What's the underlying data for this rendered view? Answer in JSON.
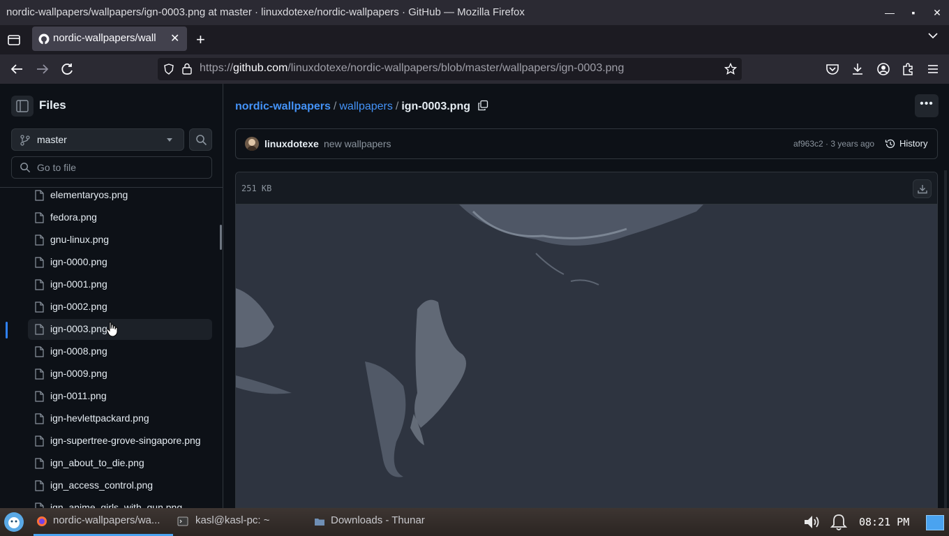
{
  "window": {
    "title": "nordic-wallpapers/wallpapers/ign-0003.png at master · linuxdotexe/nordic-wallpapers · GitHub — Mozilla Firefox"
  },
  "browser": {
    "tab_label": "nordic-wallpapers/wall",
    "url_prefix": "https://",
    "url_host": "github.com",
    "url_path": "/linuxdotexe/nordic-wallpapers/blob/master/wallpapers/ign-0003.png"
  },
  "sidebar": {
    "title": "Files",
    "branch": "master",
    "goto_placeholder": "Go to file",
    "files": [
      "elementaryos.png",
      "fedora.png",
      "gnu-linux.png",
      "ign-0000.png",
      "ign-0001.png",
      "ign-0002.png",
      "ign-0003.png",
      "ign-0008.png",
      "ign-0009.png",
      "ign-0011.png",
      "ign-hevlettpackard.png",
      "ign-supertree-grove-singapore.png",
      "ign_about_to_die.png",
      "ign_access_control.png",
      "ign_anime_girls_with_gun.png"
    ],
    "active_file": "ign-0003.png"
  },
  "breadcrumb": {
    "repo": "nordic-wallpapers",
    "sep": "/",
    "folder": "wallpapers",
    "file": "ign-0003.png"
  },
  "commit": {
    "author": "linuxdotexe",
    "message": "new wallpapers",
    "meta": "af963c2 · 3 years ago",
    "history_label": "History"
  },
  "viewer": {
    "file_size": "251 KB"
  },
  "taskbar": {
    "items": [
      {
        "label": "nordic-wallpapers/wa...",
        "icon": "firefox-icon",
        "active": true
      },
      {
        "label": "kasl@kasl-pc: ~",
        "icon": "terminal-icon",
        "active": false
      },
      {
        "label": "Downloads - Thunar",
        "icon": "folder-icon",
        "active": false
      }
    ],
    "clock": "08:21 PM"
  },
  "colors": {
    "link": "#4493f8",
    "bg": "#0d1117",
    "wallpaper": "#2e3440"
  }
}
